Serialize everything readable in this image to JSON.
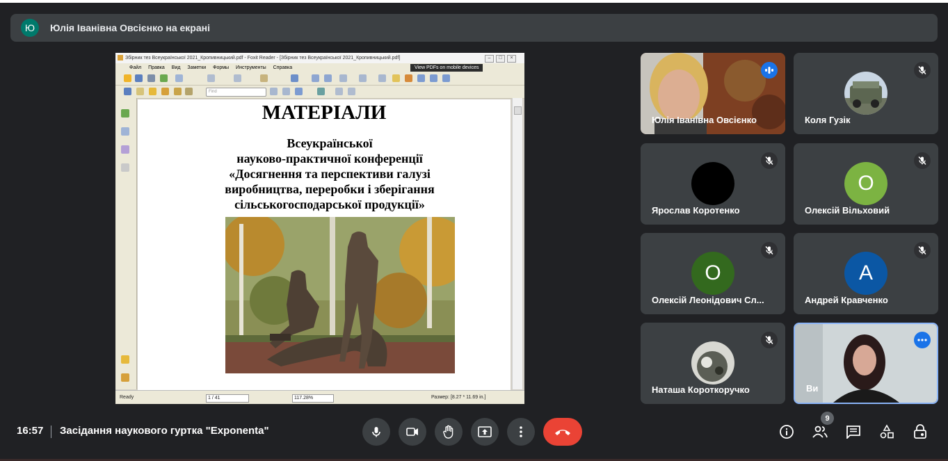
{
  "banner": {
    "avatar_letter": "Ю",
    "text": "Юлія Іванівна Овсієнко на екрані"
  },
  "shared_screen": {
    "window_title": "Збірник тез Всеукраїнської 2021_Кропивницький.pdf - Foxit Reader - [Збірник тез Всеукраїнської 2021_Кропивницький.pdf]",
    "menu": [
      "Файл",
      "Правка",
      "Вид",
      "Заметки",
      "Формы",
      "Инструменты",
      "Справка"
    ],
    "promo": "View PDFs on mobile devices",
    "find_placeholder": "Find",
    "document": {
      "title": "МАТЕРІАЛИ",
      "line1": "Всеукраїнської",
      "line2": "науково-практичної конференції",
      "line3": "«Досягнення та перспективи галузі",
      "line4": "виробництва, переробки і зберігання",
      "line5": "сільськогосподарської продукції»"
    },
    "status": {
      "ready": "Ready",
      "page": "1 / 41",
      "zoom": "117.28%",
      "size": "Размер: [8.27 * 11.69 in.]"
    }
  },
  "participants": [
    {
      "name": "Юлія Іванівна Овсієнко",
      "type": "video",
      "speaking": true
    },
    {
      "name": "Коля Гузік",
      "type": "photo",
      "muted": true
    },
    {
      "name": "Ярослав Коротенко",
      "type": "avatar",
      "color": "#000000",
      "letter": "",
      "muted": true
    },
    {
      "name": "Олексій Вільховий",
      "type": "avatar",
      "color": "#7cb342",
      "letter": "О",
      "muted": true
    },
    {
      "name": "Олексій Леонідович Сл...",
      "type": "avatar",
      "color": "#33691e",
      "letter": "О",
      "muted": true
    },
    {
      "name": "Андрей Кравченко",
      "type": "avatar",
      "color": "#0b57a4",
      "letter": "А",
      "muted": true
    },
    {
      "name": "Наташа Короткоручко",
      "type": "photo",
      "muted": true
    },
    {
      "name": "Ви",
      "type": "video",
      "active": true
    }
  ],
  "bottom_bar": {
    "time": "16:57",
    "meeting_title": "Засідання наукового гуртка \"Exponenta\"",
    "participant_count": "9"
  },
  "colors": {
    "background": "#202124",
    "tile": "#3c4043",
    "end_call": "#ea4335",
    "accent": "#1a73e8"
  }
}
